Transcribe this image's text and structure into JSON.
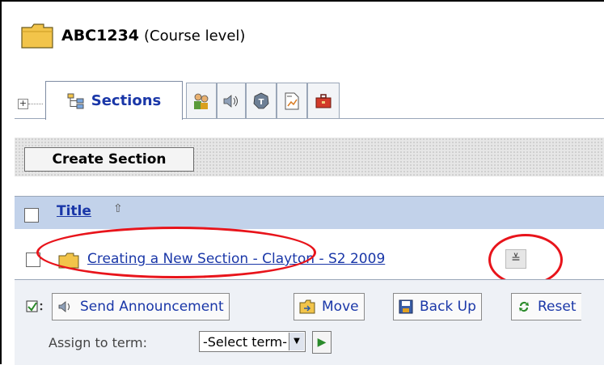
{
  "header": {
    "course_code": "ABC1234",
    "course_level": "(Course level)"
  },
  "tabs": [
    {
      "label": "Sections",
      "icon": "sections-tree-icon",
      "active": true
    },
    {
      "label": "",
      "icon": "users-icon"
    },
    {
      "label": "",
      "icon": "announcements-speaker-icon"
    },
    {
      "label": "",
      "icon": "tools-badge-icon"
    },
    {
      "label": "",
      "icon": "report-icon"
    },
    {
      "label": "",
      "icon": "briefcase-icon"
    }
  ],
  "toolbar": {
    "create_label": "Create Section"
  },
  "list": {
    "title_header": "Title",
    "sort_arrow": "⇧",
    "rows": [
      {
        "title": "Creating a New Section - Clayton - S2 2009"
      }
    ]
  },
  "actions": {
    "send_announcement": "Send Announcement",
    "move": "Move",
    "back_up": "Back Up",
    "reset": "Reset"
  },
  "assign": {
    "label": "Assign to term:",
    "select_value": "-Select term-"
  },
  "colors": {
    "link": "#1a37a8",
    "header_band": "#c2d2ea",
    "highlight": "#e8141b"
  }
}
